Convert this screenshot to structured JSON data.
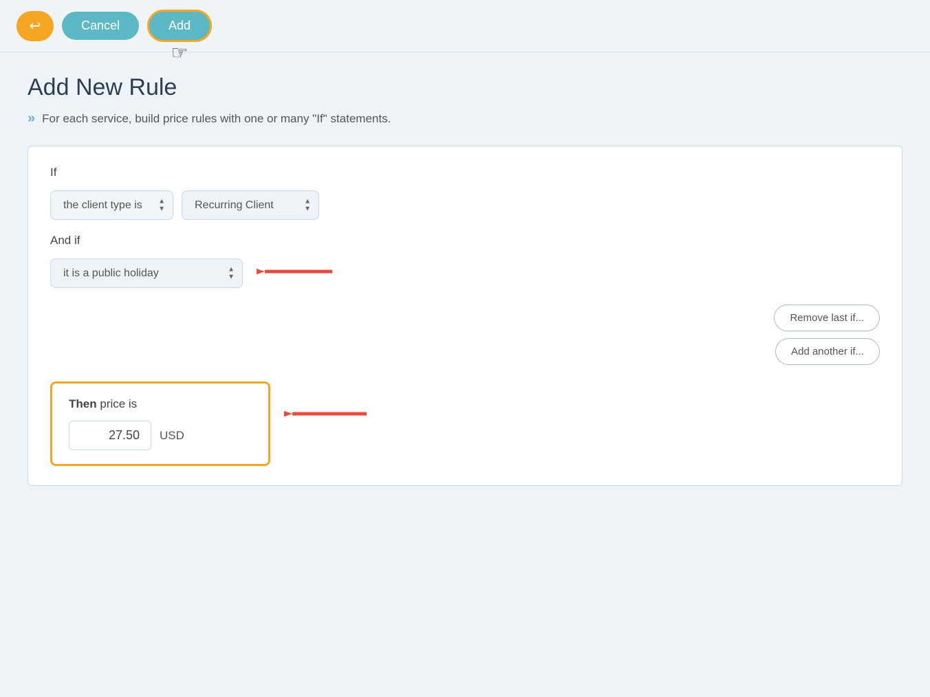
{
  "toolbar": {
    "back_label": "↩",
    "cancel_label": "Cancel",
    "add_label": "Add"
  },
  "page": {
    "title": "Add New Rule",
    "subtitle": "For each service, build price rules with one or many \"If\" statements."
  },
  "rule": {
    "if_label": "If",
    "and_if_label": "And if",
    "condition1_option": "the client type is",
    "condition1_value": "Recurring Client",
    "condition2_option": "it is a public holiday",
    "remove_btn": "Remove last if...",
    "add_another_btn": "Add another if..."
  },
  "then_section": {
    "label_then": "Then",
    "label_rest": " price is",
    "price_value": "27.50",
    "currency": "USD"
  }
}
